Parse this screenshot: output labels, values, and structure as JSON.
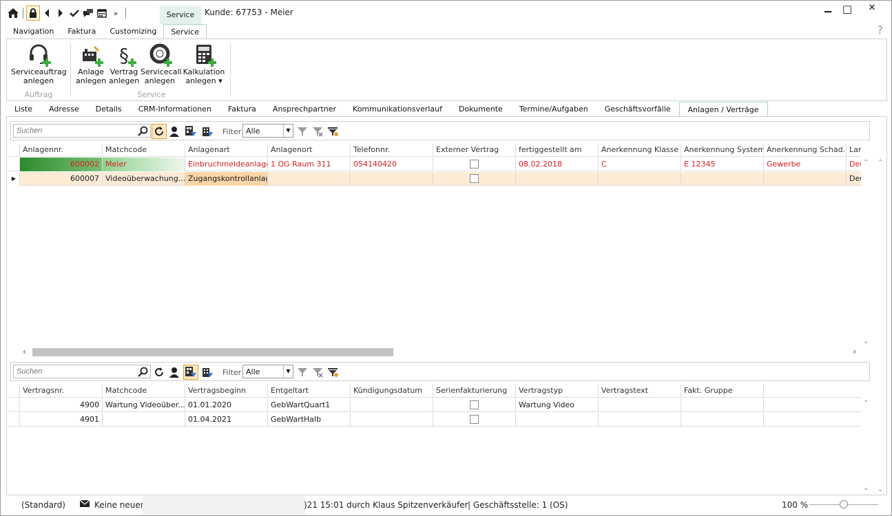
{
  "window": {
    "context_tab": "Service",
    "title": "Kunde: 67753 - Meier",
    "minimize": "▁",
    "maximize": "□",
    "close": "✕",
    "help": "?"
  },
  "ribbon_tabs": [
    "Navigation",
    "Faktura",
    "Customizing",
    "Service"
  ],
  "ribbon": {
    "serviceauftrag": "Serviceauftrag\nanlegen",
    "anlage": "Anlage\nanlegen",
    "vertrag": "Vertrag\nanlegen",
    "servicecall": "Servicecall\nanlegen",
    "kalkulation": "Kalkulation\nanlegen ▾",
    "group_auftrag": "Auftrag",
    "group_service": "Service"
  },
  "content_tabs": [
    "Liste",
    "Adresse",
    "Details",
    "CRM-Informationen",
    "Faktura",
    "Ansprechpartner",
    "Kommunikationsverlauf",
    "Dokumente",
    "Termine/Aufgaben",
    "Geschäftsvorfälle",
    "Anlagen / Verträge"
  ],
  "toolbar": {
    "search_placeholder": "Suchen",
    "filter_label": "Filter",
    "filter_value": "Alle"
  },
  "anlagen": {
    "headers": [
      "Anlagennr.",
      "Matchcode",
      "Anlagenart",
      "Anlagenort",
      "Telefonnr.",
      "Externer Vertrag",
      "fertiggestellt am",
      "Anerkennung Klasse",
      "Anerkennung System...",
      "Anerkennung Schad...",
      "Lar"
    ],
    "rows": [
      [
        "600002",
        "Meier",
        "Einbruchmeldeanlage",
        "1 OG Raum 311",
        "054140420",
        "",
        "08.02.2018",
        "C",
        "E 12345",
        "Gewerbe",
        "Deu"
      ],
      [
        "600007",
        "Videoüberwachung...",
        "Zugangskontrollanlage",
        "",
        "",
        "",
        "",
        "",
        "",
        "",
        "Deu"
      ]
    ]
  },
  "vertraege": {
    "headers": [
      "Vertragsnr.",
      "Matchcode",
      "Vertragsbeginn",
      "Entgeltart",
      "Kündigungsdatum",
      "Serienfakturierung",
      "Vertragstyp",
      "Vertragstext",
      "Fakt. Gruppe"
    ],
    "rows": [
      [
        "4900",
        "Wartung Videoüber...",
        "01.01.2020",
        "GebWartQuart1",
        "",
        "",
        "Wartung Video",
        "",
        ""
      ],
      [
        "4901",
        "",
        "01.04.2021",
        "GebWartHalb",
        "",
        "",
        "",
        "",
        ""
      ]
    ]
  },
  "status": {
    "standard": "(Standard)",
    "messages": "Keine neuen I",
    "changed": ")21 15:01 durch Klaus Spitzenverkäufer",
    "office": "| Geschäftsstelle:  1 (OS)",
    "zoom": "100 %"
  },
  "colors": {
    "accent_border": "#a8d4cc",
    "context_tab_bg": "#e4f1ef",
    "highlight_row": "#fdebd6",
    "red_text": "#d62020",
    "green_cell": "#2e8b2e"
  }
}
